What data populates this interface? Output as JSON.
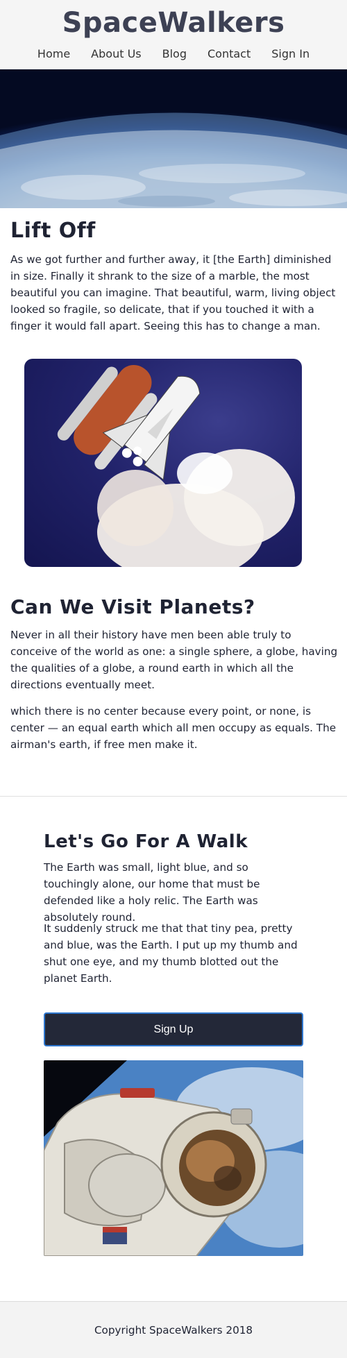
{
  "header": {
    "brand": "SpaceWalkers",
    "nav": [
      "Home",
      "About Us",
      "Blog",
      "Contact",
      "Sign In"
    ]
  },
  "section_liftoff": {
    "title": "Lift Off",
    "body": "As we got further and further away, it [the Earth] diminished in size. Finally it shrank to the size of a marble, the most beautiful you can imagine. That beautiful, warm, living object looked so fragile, so delicate, that if you touched it with a finger it would fall apart. Seeing this has to change a man."
  },
  "section_planets": {
    "title": "Can We Visit Planets?",
    "body1": "Never in all their history have men been able truly to conceive of the world as one: a single sphere, a globe, having the qualities of a globe, a round earth in which all the directions eventually meet.",
    "body2": "which there is no center because every point, or none, is center — an equal earth which all men occupy as equals. The airman's earth, if free men make it."
  },
  "section_walk": {
    "title": "Let's Go For A Walk",
    "body1": "The Earth was small, light blue, and so touchingly alone, our home that must be defended like a holy relic. The Earth was absolutely round.",
    "body2": "It suddenly struck me that that tiny pea, pretty and blue, was the Earth. I put up my thumb and shut one eye, and my thumb blotted out the planet Earth.",
    "button": "Sign Up"
  },
  "footer": {
    "copyright": "Copyright SpaceWalkers 2018"
  },
  "colors": {
    "heading": "#1f2333",
    "brand": "#3d4154",
    "button_bg": "#232838",
    "button_border": "#2f78d0"
  }
}
